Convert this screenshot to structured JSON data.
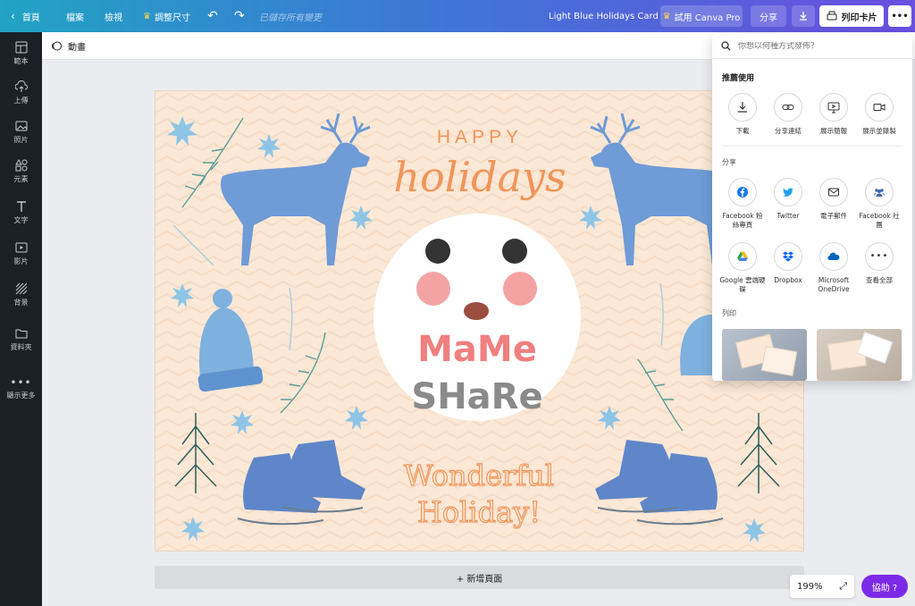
{
  "topbar": {
    "home": "首頁",
    "file": "檔案",
    "view": "檢視",
    "resize": "調整尺寸",
    "saved_status": "已儲存所有變更",
    "doc_title": "Light Blue Holidays Card",
    "try_pro": "試用 Canva Pro",
    "share": "分享",
    "print_card": "列印卡片"
  },
  "sidebar": {
    "items": [
      {
        "label": "範本",
        "icon": "template-icon"
      },
      {
        "label": "上傳",
        "icon": "upload-icon"
      },
      {
        "label": "照片",
        "icon": "photo-icon"
      },
      {
        "label": "元素",
        "icon": "elements-icon"
      },
      {
        "label": "文字",
        "icon": "text-icon"
      },
      {
        "label": "影片",
        "icon": "video-icon"
      },
      {
        "label": "背景",
        "icon": "background-icon"
      },
      {
        "label": "資料夾",
        "icon": "folder-icon"
      },
      {
        "label": "顯示更多",
        "icon": "more-icon"
      }
    ]
  },
  "animate": {
    "label": "動畫"
  },
  "card": {
    "happy": "HAPPY",
    "holidays": "holidays",
    "logo_top": "MaMe",
    "logo_bottom": "SHaRe",
    "wonderful": "Wonderful",
    "holiday": "Holiday!"
  },
  "add_page": "+ 新增頁面",
  "zoom": "199%",
  "help": "協助 ?",
  "panel": {
    "search_placeholder": "你想以何種方式發佈？",
    "recommended_heading": "推薦使用",
    "recommended": [
      "下載",
      "分享連結",
      "展示簡報",
      "展示並錄製"
    ],
    "share_heading": "分享",
    "share_row1": [
      "Facebook 粉絲專頁",
      "Twitter",
      "電子郵件",
      "Facebook 社團"
    ],
    "share_row2": [
      "Google 雲端硬碟",
      "Dropbox",
      "Microsoft OneDrive",
      "查看全部"
    ],
    "print_heading": "列印"
  },
  "colors": {
    "brand_purple": "#7d2ae8",
    "card_bg": "#fbe8d6",
    "orange_text": "#f0955a",
    "blue_art": "#6f9bd6"
  }
}
